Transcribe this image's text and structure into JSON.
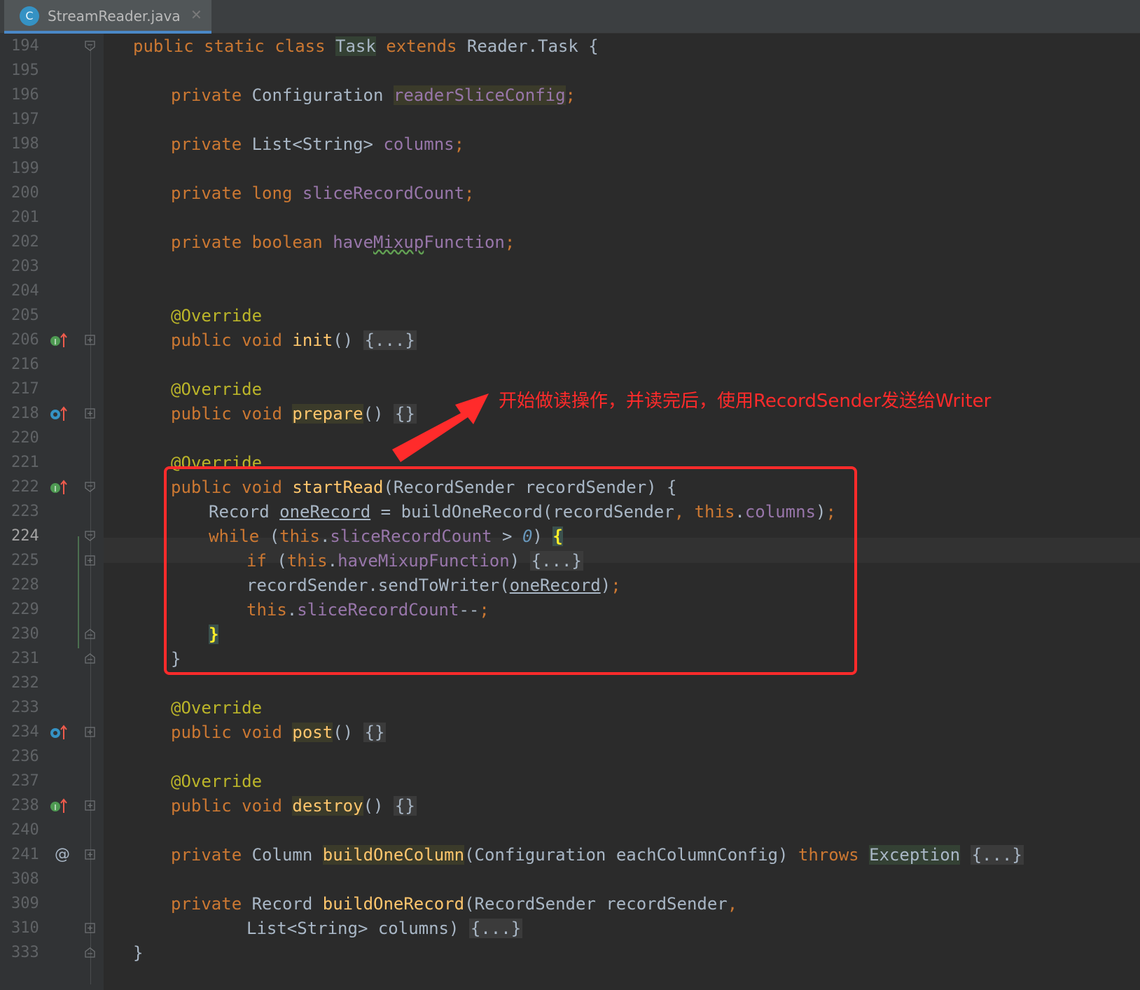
{
  "tab": {
    "title": "StreamReader.java",
    "icon_letter": "C",
    "close_glyph": "✕"
  },
  "annotation": {
    "text": "开始做读操作，并读完后，使用RecordSender发送给Writer",
    "color": "#ff2b2b"
  },
  "lines": {
    "l194": "194",
    "l195": "195",
    "l196": "196",
    "l197": "197",
    "l198": "198",
    "l199": "199",
    "l200": "200",
    "l201": "201",
    "l202": "202",
    "l203": "203",
    "l204": "204",
    "l205": "205",
    "l206": "206",
    "l216": "216",
    "l217": "217",
    "l218": "218",
    "l220": "220",
    "l221": "221",
    "l222": "222",
    "l223": "223",
    "l224": "224",
    "l225": "225",
    "l228": "228",
    "l229": "229",
    "l230": "230",
    "l231": "231",
    "l232": "232",
    "l233": "233",
    "l234": "234",
    "l236": "236",
    "l237": "237",
    "l238": "238",
    "l240": "240",
    "l241": "241",
    "l308": "308",
    "l309": "309",
    "l310": "310",
    "l333": "333"
  },
  "tok": {
    "public": "public",
    "static": "static",
    "class": "class",
    "private": "private",
    "extends": "extends",
    "long": "long",
    "boolean": "boolean",
    "void": "void",
    "while": "while",
    "if": "if",
    "this": "this",
    "throws": "throws",
    "override": "@Override",
    "Task": "Task",
    "ReaderTask": "Reader.Task {",
    "Configuration": "Configuration",
    "readerSliceConfig": "readerSliceConfig",
    "ListString": "List<String>",
    "columns": "columns",
    "sliceRecordCount": "sliceRecordCount",
    "have": "have",
    "Mixup": "Mixup",
    "Function": "Function",
    "haveMixupFunction": "haveMixupFunction",
    "init": "init",
    "prepare": "prepare",
    "startRead": "startRead",
    "post": "post",
    "destroy": "destroy",
    "buildOneColumn": "buildOneColumn",
    "buildOneRecord": "buildOneRecord",
    "Record": "Record",
    "oneRecord": "oneRecord",
    "recordSender": "recordSender",
    "RecordSender": "RecordSender",
    "sendToWriter": "sendToWriter",
    "Column": "Column",
    "eachColumnConfig": "eachColumnConfig",
    "Exception": "Exception",
    "zero": "0",
    "folded": "{...}",
    "empty": "{}",
    "semi": ";",
    "parens": "()",
    "lbrace": "{",
    "rbrace": "}",
    "openParen": "(",
    "closeParen": ")",
    "closeParenBrace": ") {",
    "closeParenComma": ")",
    "comma": ",",
    "dot": ".",
    "assign": " = ",
    "gt": " > ",
    "decr": "--",
    "closeParenSemi": ");"
  }
}
